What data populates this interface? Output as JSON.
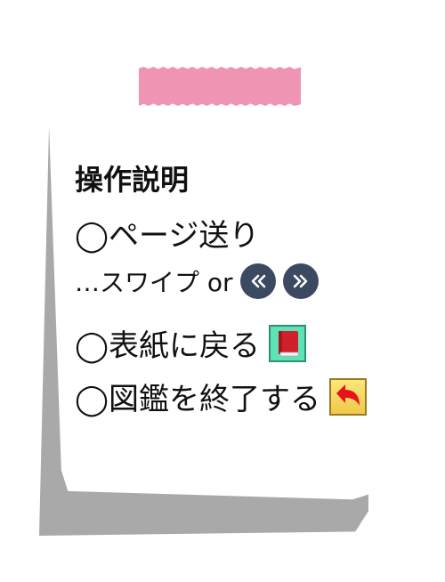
{
  "title": "操作説明",
  "items": [
    {
      "label": "◯ページ送り"
    },
    {
      "label": "…スワイプ or"
    },
    {
      "label": "◯表紙に戻る"
    },
    {
      "label": "◯図鑑を終了する"
    }
  ],
  "icons": {
    "prev": "double-chevron-left-icon",
    "next": "double-chevron-right-icon",
    "cover": "red-book-icon",
    "exit": "return-arrow-icon"
  },
  "colors": {
    "tape": "#ef94b2",
    "nav_button": "#3b4a60",
    "book_bg": "#5ee3b8",
    "exit_bg": "#f0c94a",
    "arrow": "#e8121a"
  }
}
